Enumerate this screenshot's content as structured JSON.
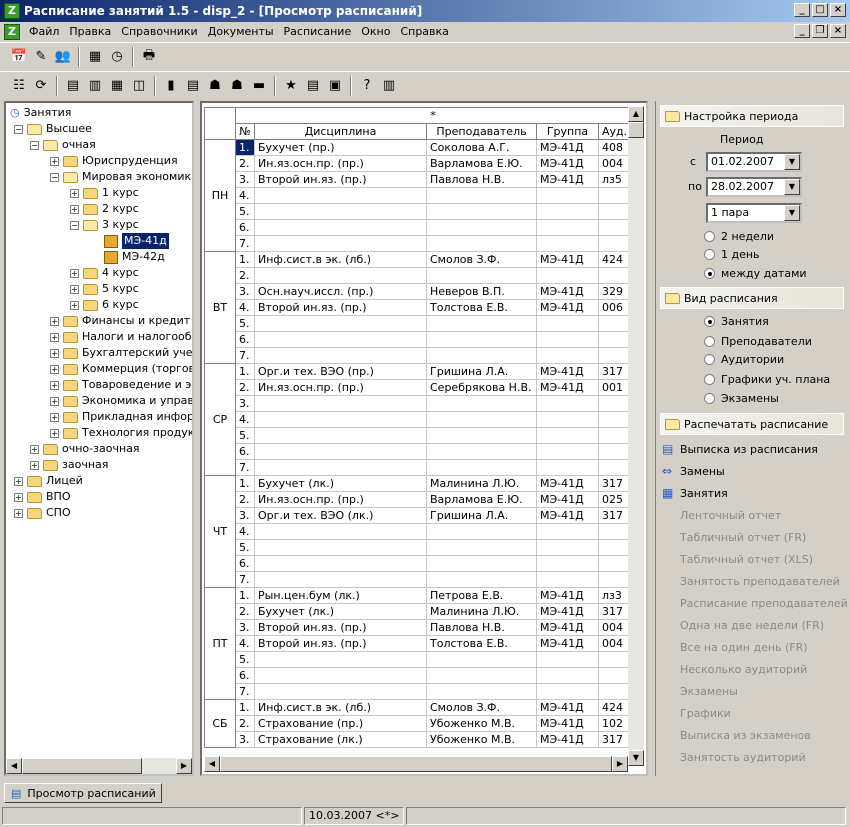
{
  "window": {
    "title": "Расписание занятий 1.5 - disp_2 - [Просмотр расписаний]"
  },
  "menu": [
    "Файл",
    "Правка",
    "Справочники",
    "Документы",
    "Расписание",
    "Окно",
    "Справка"
  ],
  "tree": {
    "root": "Занятия",
    "level1": "Высшее",
    "level2": "очная",
    "level3a": "Юриспруденция",
    "level3b": "Мировая экономика",
    "courses": [
      "1 курс",
      "2 курс",
      "3 курс"
    ],
    "groups": [
      "МЭ-41д",
      "МЭ-42д"
    ],
    "courses2": [
      "4 курс",
      "5 курс",
      "6 курс"
    ],
    "others": [
      "Финансы и кредит",
      "Налоги и налогообло",
      "Бухгалтерский учет",
      "Коммерция (торгово",
      "Товароведение и эк",
      "Экономика и управл",
      "Прикладная информ",
      "Технология продукт"
    ],
    "forms": [
      "очно-заочная",
      "заочная"
    ],
    "top": [
      "Лицей",
      "ВПО",
      "СПО"
    ]
  },
  "grid": {
    "group_header": "*",
    "columns": [
      "№",
      "Дисциплина",
      "Преподаватель",
      "Группа",
      "Ауд."
    ],
    "days": [
      {
        "day": "ПН",
        "rows": [
          [
            "1.",
            "Бухучет (пр.)",
            "Соколова А.Г.",
            "МЭ-41Д",
            "408"
          ],
          [
            "2.",
            "Ин.яз.осн.пр. (пр.)",
            "Варламова  Е.Ю.",
            "МЭ-41Д",
            "004"
          ],
          [
            "3.",
            "Второй ин.яз. (пр.)",
            "Павлова Н.В.",
            "МЭ-41Д",
            "лз5"
          ],
          [
            "4.",
            "",
            "",
            "",
            ""
          ],
          [
            "5.",
            "",
            "",
            "",
            ""
          ],
          [
            "6.",
            "",
            "",
            "",
            ""
          ],
          [
            "7.",
            "",
            "",
            "",
            ""
          ]
        ]
      },
      {
        "day": "ВТ",
        "rows": [
          [
            "1.",
            "Инф.сист.в эк. (лб.)",
            "Смолов З.Ф.",
            "МЭ-41Д",
            "424"
          ],
          [
            "2.",
            "",
            "",
            "",
            ""
          ],
          [
            "3.",
            "Осн.науч.иссл. (пр.)",
            "Неверов В.П.",
            "МЭ-41Д",
            "329"
          ],
          [
            "4.",
            "Второй ин.яз. (пр.)",
            "Толстова Е.В.",
            "МЭ-41Д",
            "006"
          ],
          [
            "5.",
            "",
            "",
            "",
            ""
          ],
          [
            "6.",
            "",
            "",
            "",
            ""
          ],
          [
            "7.",
            "",
            "",
            "",
            ""
          ]
        ]
      },
      {
        "day": "СР",
        "rows": [
          [
            "1.",
            "Орг.и тех.  ВЭО (пр.)",
            "Гришина Л.А.",
            "МЭ-41Д",
            "317"
          ],
          [
            "2.",
            "Ин.яз.осн.пр. (пр.)",
            "Серебрякова Н.В.",
            "МЭ-41Д",
            "001"
          ],
          [
            "3.",
            "",
            "",
            "",
            ""
          ],
          [
            "4.",
            "",
            "",
            "",
            ""
          ],
          [
            "5.",
            "",
            "",
            "",
            ""
          ],
          [
            "6.",
            "",
            "",
            "",
            ""
          ],
          [
            "7.",
            "",
            "",
            "",
            ""
          ]
        ]
      },
      {
        "day": "ЧТ",
        "rows": [
          [
            "1.",
            "Бухучет (лк.)",
            "Малинина Л.Ю.",
            "МЭ-41Д",
            "317"
          ],
          [
            "2.",
            "Ин.яз.осн.пр. (пр.)",
            "Варламова  Е.Ю.",
            "МЭ-41Д",
            "025"
          ],
          [
            "3.",
            "Орг.и тех.  ВЭО (лк.)",
            "Гришина Л.А.",
            "МЭ-41Д",
            "317"
          ],
          [
            "4.",
            "",
            "",
            "",
            ""
          ],
          [
            "5.",
            "",
            "",
            "",
            ""
          ],
          [
            "6.",
            "",
            "",
            "",
            ""
          ],
          [
            "7.",
            "",
            "",
            "",
            ""
          ]
        ]
      },
      {
        "day": "ПТ",
        "rows": [
          [
            "1.",
            "Рын.цен.бум (лк.)",
            "Петрова Е.В.",
            "МЭ-41Д",
            "лз3"
          ],
          [
            "2.",
            "Бухучет (лк.)",
            "Малинина Л.Ю.",
            "МЭ-41Д",
            "317"
          ],
          [
            "3.",
            "Второй ин.яз. (пр.)",
            "Павлова Н.В.",
            "МЭ-41Д",
            "004"
          ],
          [
            "4.",
            "Второй ин.яз. (пр.)",
            "Толстова Е.В.",
            "МЭ-41Д",
            "004"
          ],
          [
            "5.",
            "",
            "",
            "",
            ""
          ],
          [
            "6.",
            "",
            "",
            "",
            ""
          ],
          [
            "7.",
            "",
            "",
            "",
            ""
          ]
        ]
      },
      {
        "day": "СБ",
        "rows": [
          [
            "1.",
            "Инф.сист.в эк. (лб.)",
            "Смолов З.Ф.",
            "МЭ-41Д",
            "424"
          ],
          [
            "2.",
            "Страхование (пр.)",
            "Убоженко М.В.",
            "МЭ-41Д",
            "102"
          ],
          [
            "3.",
            "Страхование (лк.)",
            "Убоженко М.В.",
            "МЭ-41Д",
            "317"
          ]
        ]
      }
    ]
  },
  "period": {
    "header": "Настройка периода",
    "label": "Период",
    "from_label": "с",
    "from": "01.02.2007",
    "to_label": "по",
    "to": "28.02.2007",
    "pair": "1 пара",
    "options": [
      "2 недели",
      "1 день",
      "между датами"
    ],
    "selected": 2
  },
  "view": {
    "header": "Вид расписания",
    "options": [
      "Занятия",
      "Преподаватели",
      "Аудитории",
      "Графики уч. плана",
      "Экзамены"
    ],
    "selected": 0
  },
  "print": {
    "header": "Распечатать расписание",
    "enabled": [
      "Выписка из расписания",
      "Замены",
      "Занятия"
    ],
    "disabled": [
      "Ленточный отчет",
      "Табличный отчет (FR)",
      "Табличный отчет (XLS)",
      "Занятость преподавателей",
      "Расписание преподавателей",
      "Одна на две недели (FR)",
      "Все на один день (FR)",
      "Несколько аудиторий",
      "Экзамены",
      "Графики",
      "Выписка из экзаменов",
      "Занятость аудиторий"
    ]
  },
  "tab": "Просмотр расписаний",
  "status": {
    "date": "10.03.2007 <*>"
  }
}
